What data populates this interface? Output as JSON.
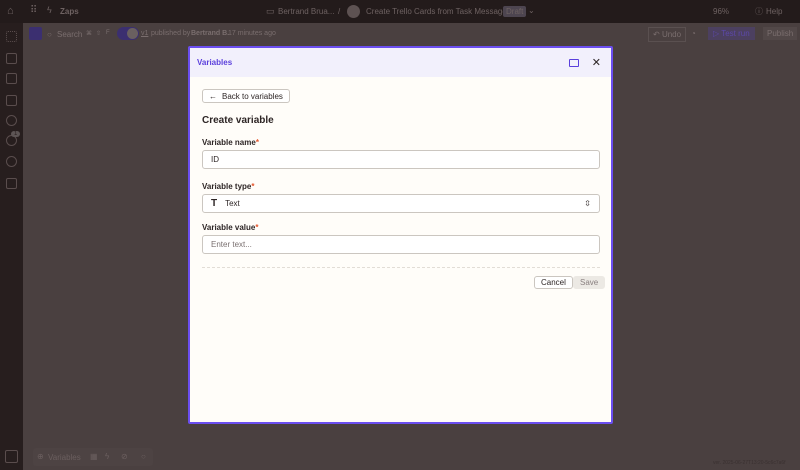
{
  "topbar": {
    "app": "Zaps",
    "folder": "Bertrand Brua...",
    "separator": "/",
    "zap_title": "Create Trello Cards from Task Messages",
    "status_badge": "Draft",
    "zoom": "96%",
    "help": "Help"
  },
  "subbar": {
    "search": "Search",
    "keys": [
      "⌘",
      "⇧",
      "F"
    ],
    "version": "v1",
    "published_prefix": "published by",
    "published_by": "Bertrand B.",
    "published_time": "17 minutes ago",
    "undo": "Undo",
    "test_run": "Test run",
    "publish": "Publish"
  },
  "sidebar": {
    "badge": "1"
  },
  "bottom": {
    "variables": "Variables",
    "version": "ver. 2025-06-27T13:20-5c6c7a6f"
  },
  "modal": {
    "title": "Variables",
    "back": "Back to variables",
    "heading": "Create variable",
    "name_label": "Variable name",
    "name_value": "ID",
    "type_label": "Variable type",
    "type_value": "Text",
    "value_label": "Variable value",
    "value_placeholder": "Enter text...",
    "required": "*",
    "cancel": "Cancel",
    "save": "Save"
  },
  "colors": {
    "accent": "#6b4ef0",
    "required": "#e4572e"
  }
}
